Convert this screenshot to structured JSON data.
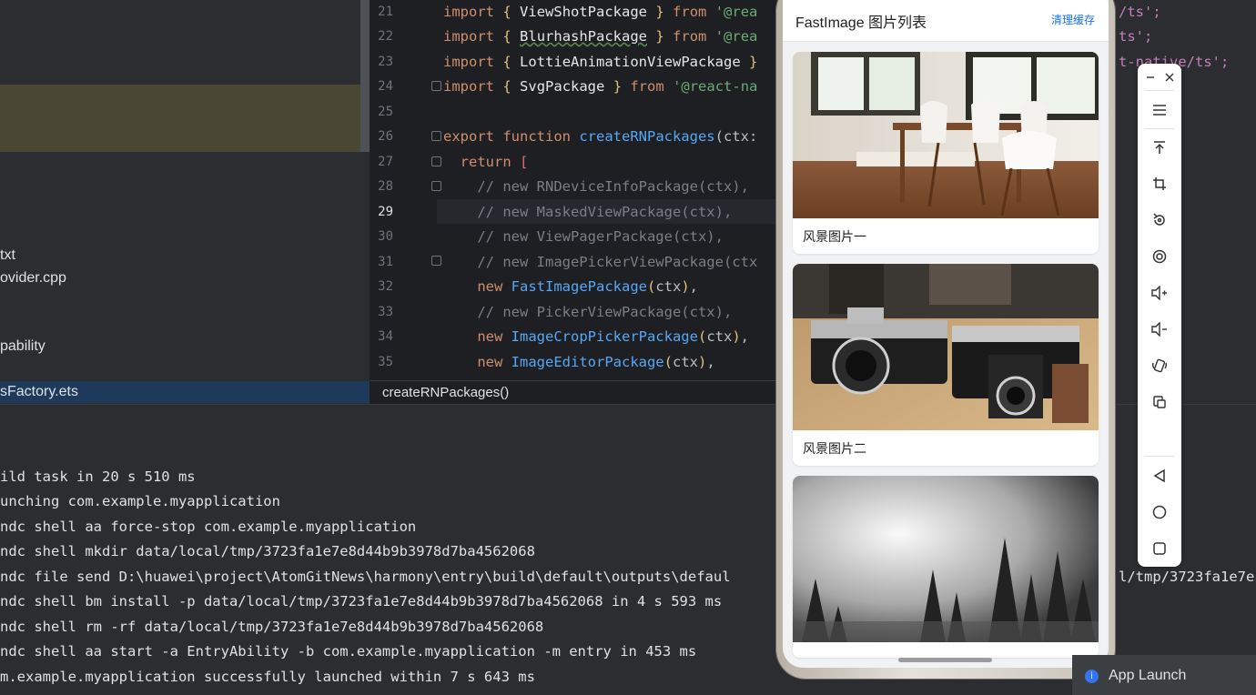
{
  "project_tree": {
    "items": [
      {
        "label": "txt",
        "y": 0
      },
      {
        "label": "ovider.cpp",
        "y": 0
      },
      {
        "label": "pability",
        "y": 0
      }
    ],
    "selected_file": "sFactory.ets"
  },
  "editor": {
    "line_numbers": [
      "21",
      "22",
      "23",
      "24",
      "25",
      "26",
      "27",
      "28",
      "29",
      "30",
      "31",
      "32",
      "33",
      "34",
      "35"
    ],
    "current_line": "29",
    "breadcrumb": "createRNPackages()"
  },
  "right_code": {
    "l21": "/ts';",
    "l22": "ts';",
    "l23": "t-native/ts';"
  },
  "console": {
    "lines": [
      "ild task in 20 s 510 ms",
      "unching com.example.myapplication",
      "ndc shell aa force-stop com.example.myapplication",
      "ndc shell mkdir data/local/tmp/3723fa1e7e8d44b9b3978d7ba4562068",
      "ndc file send D:\\huawei\\project\\AtomGitNews\\harmony\\entry\\build\\default\\outputs\\defaul",
      "ndc shell bm install -p data/local/tmp/3723fa1e7e8d44b9b3978d7ba4562068 in 4 s 593 ms",
      "ndc shell rm -rf data/local/tmp/3723fa1e7e8d44b9b3978d7ba4562068",
      "ndc shell aa start -a EntryAbility -b com.example.myapplication -m entry in 453 ms",
      "m.example.myapplication successfully launched within 7 s 643 ms"
    ],
    "tail_line5": "l/tmp/3723fa1e7e"
  },
  "app": {
    "title": "FastImage 图片列表",
    "clear_cache": "清理缓存",
    "cards": [
      {
        "caption": "风景图片一",
        "image": "dining-chairs-photo"
      },
      {
        "caption": "风景图片二",
        "image": "vintage-cameras-photo"
      },
      {
        "caption": "",
        "image": "foggy-forest-photo"
      }
    ]
  },
  "emulator_toolbar": {
    "buttons": [
      "minimize-icon",
      "close-icon",
      "menu-icon",
      "pin-top-icon",
      "crop-icon",
      "rotate-icon",
      "screen-record-icon",
      "volume-up-icon",
      "volume-down-icon",
      "shake-icon",
      "copy-screen-icon",
      "back-icon",
      "home-icon",
      "recents-icon"
    ]
  },
  "notification": {
    "label": "App Launch"
  },
  "colors": {
    "ide_bg": "#2b2d30",
    "editor_bg": "#1e1f22",
    "keyword": "#cf8e6d",
    "function": "#56a8f5",
    "string": "#6aab73",
    "link_blue": "#1a73e8"
  }
}
